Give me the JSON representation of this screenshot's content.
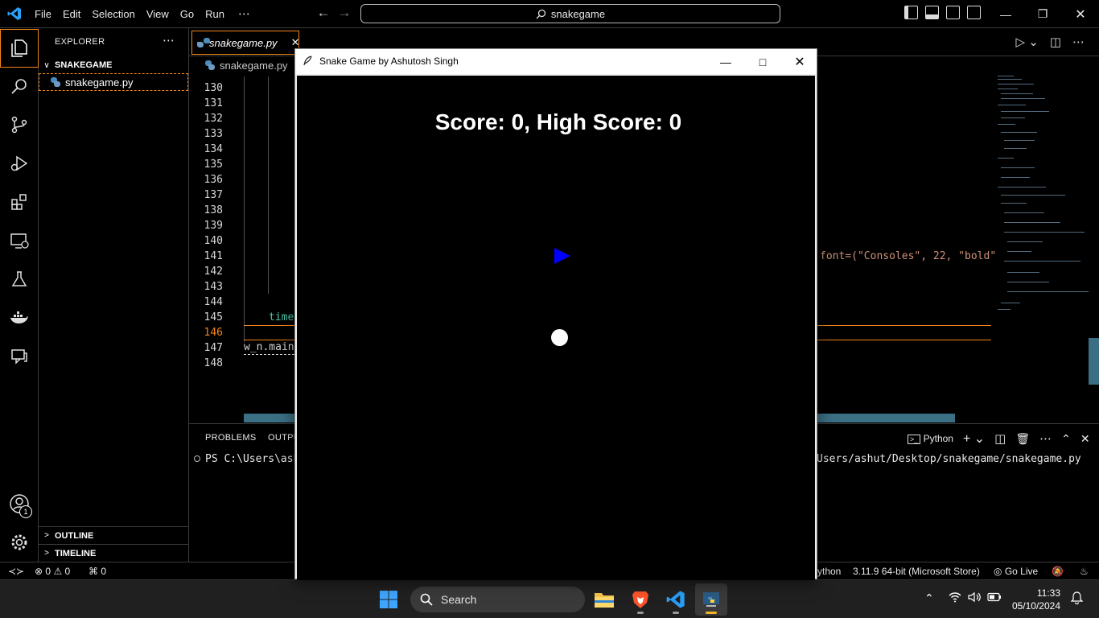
{
  "vscode": {
    "menu": [
      "File",
      "Edit",
      "Selection",
      "View",
      "Go",
      "Run",
      "⋯"
    ],
    "command_center": "snakegame",
    "explorer": {
      "title": "EXPLORER",
      "folder": "SNAKEGAME",
      "file": "snakegame.py",
      "outline": "OUTLINE",
      "timeline": "TIMELINE"
    },
    "accounts_badge": "1",
    "tab": {
      "label": "snakegame.py"
    },
    "breadcrumb": "snakegame.py",
    "line_numbers": [
      "130",
      "131",
      "132",
      "133",
      "134",
      "135",
      "136",
      "137",
      "138",
      "139",
      "140",
      "141",
      "142",
      "143",
      "144",
      "145",
      "146",
      "147",
      "148"
    ],
    "current_line": "146",
    "code": {
      "line145": "time",
      "line147": "w_n.main",
      "line141_right": "font=(\"Consoles\", 22, \"bold\""
    },
    "panel": {
      "tabs": [
        "PROBLEMS",
        "OUTPU"
      ],
      "terminal_profile": "Python",
      "terminal_prompt": "PS C:\\Users\\ashu",
      "terminal_cmd_tail": "Users/ashut/Desktop/snakegame/snakegame.py"
    },
    "status": {
      "errors": "0",
      "warnings": "0",
      "ports": "0",
      "language": "ython",
      "interpreter": "3.11.9 64-bit (Microsoft Store)",
      "golive": "Go Live"
    }
  },
  "game": {
    "window_title": "Snake Game by Ashutosh Singh",
    "score_text": "Score: 0, High Score: 0",
    "snake_color": "#0000ff",
    "food_color": "#ffffff",
    "background": "#000000"
  },
  "taskbar": {
    "search_placeholder": "Search",
    "time": "11:33",
    "date": "05/10/2024"
  }
}
